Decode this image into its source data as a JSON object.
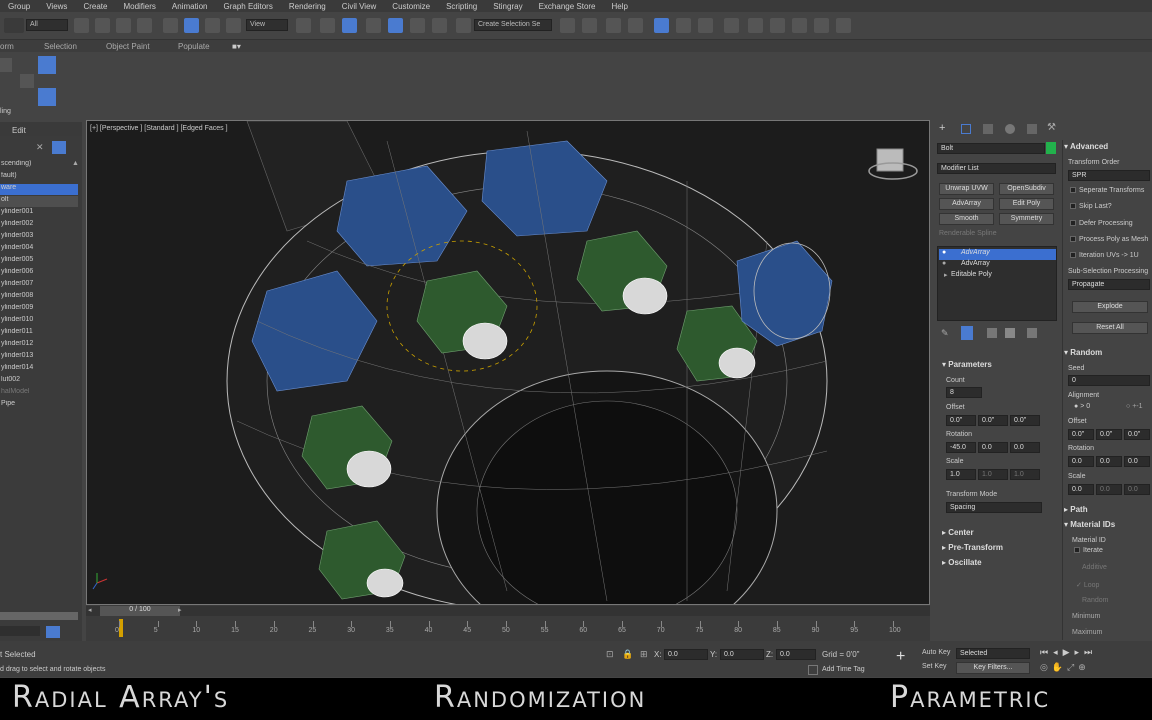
{
  "menu": [
    "Group",
    "Views",
    "Create",
    "Modifiers",
    "Animation",
    "Graph Editors",
    "Rendering",
    "Civil View",
    "Customize",
    "Scripting",
    "Stingray",
    "Exchange Store",
    "Help"
  ],
  "toolbar": {
    "filter_select": "All",
    "view_select": "View",
    "selection_set": "Create Selection Se"
  },
  "ribbon": {
    "tabs": [
      "orm",
      "Selection",
      "Object Paint",
      "Populate"
    ]
  },
  "scene_explorer": {
    "edit_menu": "Edit",
    "sort_label": "scending)",
    "items": [
      "fault)",
      "ware",
      "olt",
      "ylinder001",
      "ylinder002",
      "ylinder003",
      "ylinder004",
      "ylinder005",
      "ylinder006",
      "ylinder007",
      "ylinder008",
      "ylinder009",
      "ylinder010",
      "ylinder011",
      "ylinder012",
      "ylinder013",
      "ylinder014",
      "lut002",
      "halModel",
      "Pipe"
    ],
    "left_label": "ling"
  },
  "viewport": {
    "label": "[+] [Perspective ] [Standard ] [Edged Faces ]"
  },
  "command_panel": {
    "object_name": "Bolt",
    "modifier_list": "Modifier List",
    "object_color": "#22b14c",
    "buttons": [
      "Unwrap UVW",
      "OpenSubdiv",
      "AdvArray",
      "Edit Poly",
      "Smooth",
      "Symmetry"
    ],
    "renderable_spline": "Renderable Spline",
    "stack": [
      "AdvArray",
      "AdvArray",
      "Editable Poly"
    ],
    "parameters_title": "Parameters",
    "count_label": "Count",
    "count_value": "8",
    "offset_label": "Offset",
    "offset_values": [
      "0.0\"",
      "0.0\"",
      "0.0\""
    ],
    "rotation_label": "Rotation",
    "rotation_values": [
      "-45.0",
      "0.0",
      "0.0"
    ],
    "scale_label": "Scale",
    "scale_values": [
      "1.0",
      "1.0",
      "1.0"
    ],
    "transform_mode_label": "Transform Mode",
    "transform_mode_value": "Spacing",
    "rollouts": [
      "Center",
      "Pre-Transform",
      "Oscillate"
    ]
  },
  "advanced_panel": {
    "title": "Advanced",
    "transform_order_label": "Transform Order",
    "transform_order_value": "SPR",
    "options": [
      "Seperate Transforms",
      "Skip Last?",
      "Defer Processing",
      "Process Poly as Mesh",
      "Iteration UVs -> 1U"
    ],
    "sub_selection_label": "Sub-Selection Processing",
    "sub_selection_value": "Propagate",
    "explode_button": "Explode",
    "reset_all_button": "Reset All",
    "random_title": "Random",
    "seed_label": "Seed",
    "seed_value": "0",
    "alignment_label": "Alignment",
    "alignment_opt1": "> 0",
    "alignment_opt2": "+-1",
    "offset_label": "Offset",
    "offset_values": [
      "0.0\"",
      "0.0\"",
      "0.0\""
    ],
    "rotation_label": "Rotation",
    "rotation_values": [
      "0.0",
      "0.0",
      "0.0"
    ],
    "scale_label": "Scale",
    "scale_values": [
      "0.0",
      "0.0",
      "0.0"
    ],
    "path_title": "Path",
    "material_ids_title": "Material IDs",
    "material_id_label": "Material ID",
    "iterate_label": "Iterate",
    "additive_label": "Additive",
    "loop_label": "Loop",
    "random_label": "Random",
    "minimum_label": "Minimum",
    "maximum_label": "Maximum"
  },
  "timeline": {
    "frame_counter": "0 / 100",
    "ticks": [
      "0",
      "5",
      "10",
      "15",
      "20",
      "25",
      "30",
      "35",
      "40",
      "45",
      "50",
      "55",
      "60",
      "65",
      "70",
      "75",
      "80",
      "85",
      "90",
      "95",
      "100"
    ]
  },
  "status": {
    "selected": "t Selected",
    "hint": "d drag to select and rotate objects",
    "x_label": "X:",
    "x_value": "0.0",
    "y_label": "Y:",
    "y_value": "0.0",
    "z_label": "Z:",
    "z_value": "0.0",
    "grid": "Grid = 0'0\"",
    "add_time_tag": "Add Time Tag",
    "auto_key": "Auto Key",
    "set_key": "Set Key",
    "key_mode": "Selected",
    "key_filters": "Key Filters..."
  },
  "caption": {
    "left": "Radial Array's",
    "center": "Randomization",
    "right": "Parametric"
  }
}
